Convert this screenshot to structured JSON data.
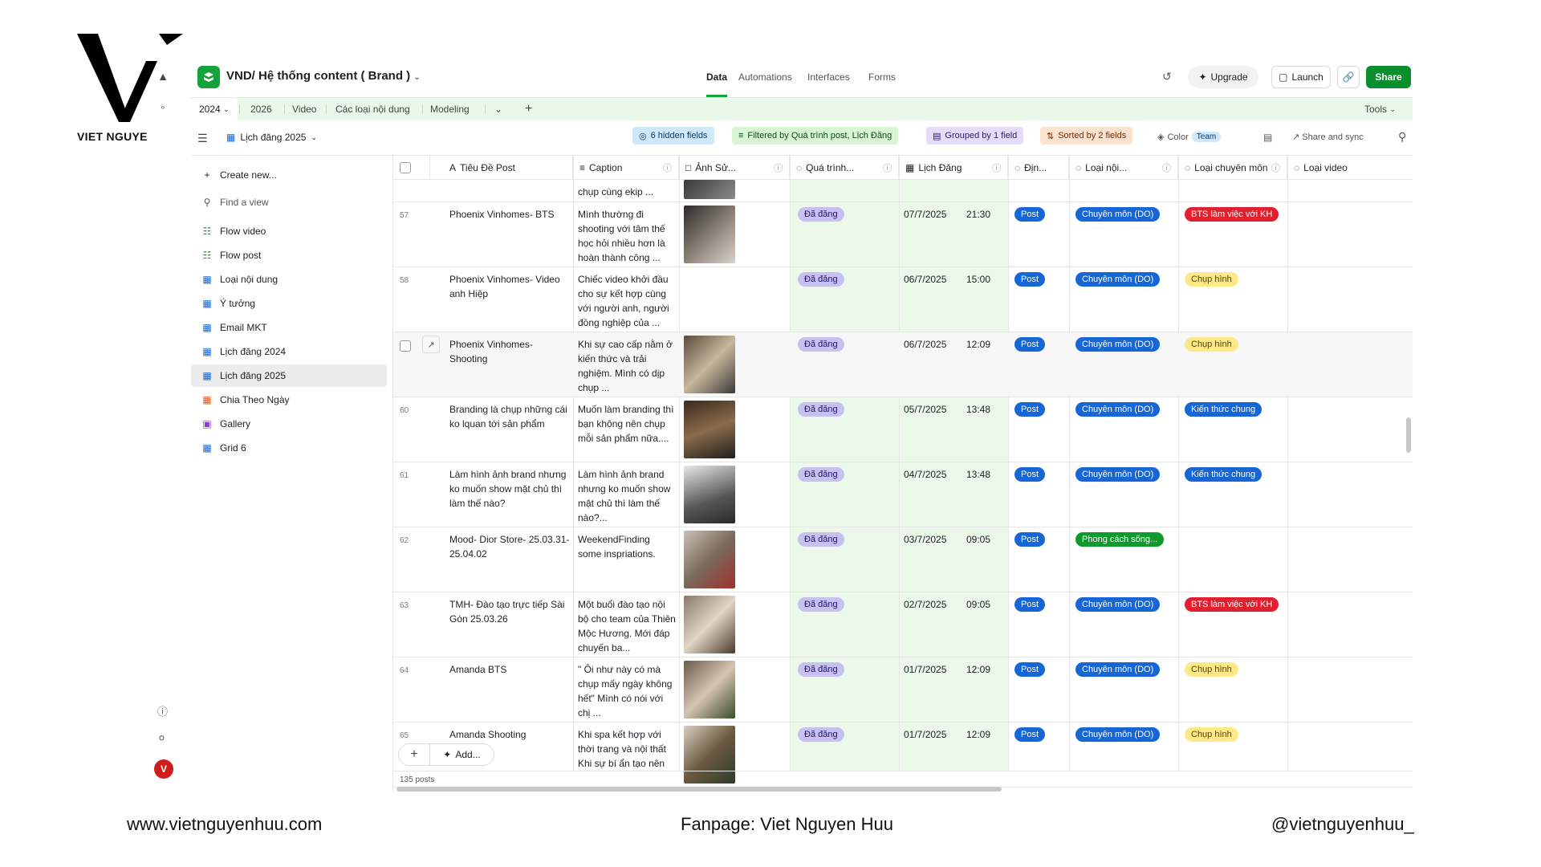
{
  "brand": {
    "name": "VIET NGUYE"
  },
  "header": {
    "base_title": "VND/ Hệ thống content ( Brand )",
    "nav": [
      "Data",
      "Automations",
      "Interfaces",
      "Forms"
    ],
    "upgrade_label": "Upgrade",
    "launch_label": "Launch",
    "share_label": "Share"
  },
  "tables": {
    "tabs": [
      "2024",
      "2026",
      "Video",
      "Các loại nội dung",
      "Modeling"
    ],
    "tools_label": "Tools"
  },
  "view_bar": {
    "view_name": "Lịch đăng 2025",
    "hidden_fields": "6 hidden fields",
    "filter": "Filtered by Quá trình post, Lịch Đăng",
    "group": "Grouped by 1 field",
    "sort": "Sorted by 2 fields",
    "color_label": "Color",
    "team_label": "Team",
    "share_sync": "Share and sync"
  },
  "sidebar": {
    "create_new": "Create new...",
    "find_view": "Find a view",
    "items": [
      {
        "label": "Flow video",
        "icon": "gantt-icon"
      },
      {
        "label": "Flow post",
        "icon": "gantt-icon"
      },
      {
        "label": "Loại nội dung",
        "icon": "grid-icon"
      },
      {
        "label": "Ý tưởng",
        "icon": "grid-icon"
      },
      {
        "label": "Email MKT",
        "icon": "grid-icon"
      },
      {
        "label": "Lịch đăng 2024",
        "icon": "grid-icon"
      },
      {
        "label": "Lịch đăng 2025",
        "icon": "grid-icon"
      },
      {
        "label": "Chia Theo Ngày",
        "icon": "calendar-icon"
      },
      {
        "label": "Gallery",
        "icon": "gallery-icon"
      },
      {
        "label": "Grid 6",
        "icon": "grid-icon"
      }
    ],
    "avatar_initial": "V"
  },
  "columns": [
    "Tiêu Đề Post",
    "Caption",
    "Ảnh Sử...",
    "Quá trình...",
    "Lịch Đăng",
    "Địn...",
    "Loại nội...",
    "Loại chuyên môn",
    "Loại video"
  ],
  "top_partial": {
    "caption": "chụp cùng ekip ..."
  },
  "rows": [
    {
      "num": "57",
      "title": "Phoenix Vinhomes- BTS",
      "caption": "Mình thường đi shooting với tâm thế học hỏi nhiều hơn là hoàn thành công ...",
      "status": "Đã đăng",
      "date": "07/7/2025",
      "time": "21:30",
      "format": "Post",
      "content_type": "Chuyên môn (DO)",
      "specialty": "BTS làm việc với KH",
      "spec_color": "red",
      "has_image": true
    },
    {
      "num": "58",
      "title": "Phoenix Vinhomes- Video anh Hiệp",
      "caption": "Chiếc video khởi đầu cho sự kết hợp cùng với người anh, người đồng nghiệp của ...",
      "status": "Đã đăng",
      "date": "06/7/2025",
      "time": "15:00",
      "format": "Post",
      "content_type": "Chuyên môn (DO)",
      "specialty": "Chụp hình",
      "spec_color": "yellow",
      "has_image": false
    },
    {
      "num": "",
      "title": "Phoenix Vinhomes- Shooting",
      "caption": "Khi sự cao cấp nằm ở kiến thức và trải nghiệm. Mình có dịp chụp ...",
      "status": "Đã đăng",
      "date": "06/7/2025",
      "time": "12:09",
      "format": "Post",
      "content_type": "Chuyên môn (DO)",
      "specialty": "Chụp hình",
      "spec_color": "yellow",
      "has_image": true
    },
    {
      "num": "60",
      "title": "Branding là chụp những cái ko lquan tới sản phẩm",
      "caption": "Muốn làm branding thì bạn không nên chụp mỗi sản phẩm nữa....",
      "status": "Đã đăng",
      "date": "05/7/2025",
      "time": "13:48",
      "format": "Post",
      "content_type": "Chuyên môn (DO)",
      "specialty": "Kiến thức chung",
      "spec_color": "blue",
      "has_image": true
    },
    {
      "num": "61",
      "title": "Làm hình ảnh brand nhưng ko muốn show mặt chủ thì làm thế nào?",
      "caption": "Làm hình ảnh brand nhưng ko muốn show mặt chủ thì làm thế nào?...",
      "status": "Đã đăng",
      "date": "04/7/2025",
      "time": "13:48",
      "format": "Post",
      "content_type": "Chuyên môn (DO)",
      "specialty": "Kiến thức chung",
      "spec_color": "blue",
      "has_image": true
    },
    {
      "num": "62",
      "title": "Mood- Dior Store- 25.03.31- 25.04.02",
      "caption": "WeekendFinding some inspriations.",
      "status": "Đã đăng",
      "date": "03/7/2025",
      "time": "09:05",
      "format": "Post",
      "content_type": "Phong cách sống...",
      "content_color": "green",
      "specialty": "",
      "spec_color": "",
      "has_image": true
    },
    {
      "num": "63",
      "title": "TMH- Đào tạo trực tiếp Sài Gòn 25.03.26",
      "caption": "Một buổi đào tạo nội bộ cho team của Thiên Mộc Hương. Mới đáp chuyến ba...",
      "status": "Đã đăng",
      "date": "02/7/2025",
      "time": "09:05",
      "format": "Post",
      "content_type": "Chuyên môn (DO)",
      "specialty": "BTS làm việc với KH",
      "spec_color": "red",
      "has_image": true
    },
    {
      "num": "64",
      "title": "Amanda BTS",
      "caption": "\" Ôi như này có mà chụp mấy ngày không hết\" Mình có nói với chị ...",
      "status": "Đã đăng",
      "date": "01/7/2025",
      "time": "12:09",
      "format": "Post",
      "content_type": "Chuyên môn (DO)",
      "specialty": "Chụp hình",
      "spec_color": "yellow",
      "has_image": true
    },
    {
      "num": "65",
      "title": "Amanda Shooting",
      "caption": "Khi spa kết hợp với thời trang và nội thất Khi sự bí ẩn tạo nên",
      "status": "Đã đăng",
      "date": "01/7/2025",
      "time": "12:09",
      "format": "Post",
      "content_type": "Chuyên môn (DO)",
      "specialty": "Chụp hình",
      "spec_color": "yellow",
      "has_image": true
    }
  ],
  "footer_grid": {
    "count": "135 posts",
    "add_label": "Add..."
  },
  "footer": {
    "website": "www.vietnguyenhuu.com",
    "fanpage": "Fanpage: Viet Nguyen Huu",
    "handle": "@vietnguyenhuu_"
  }
}
